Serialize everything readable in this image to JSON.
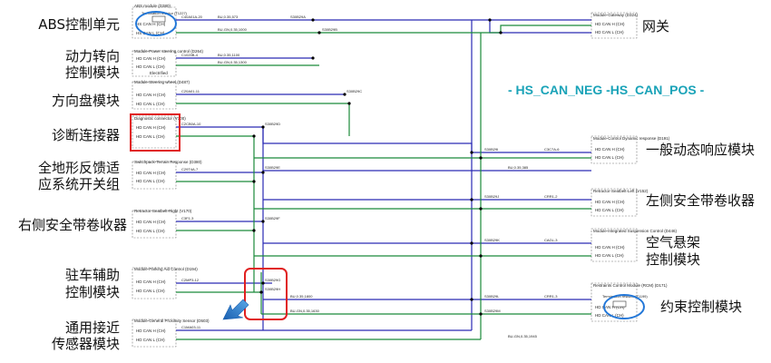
{
  "callouts_left": [
    {
      "id": "abs",
      "lines": [
        "ABS控制单元"
      ]
    },
    {
      "id": "power-steering",
      "lines": [
        "动力转向",
        "控制模块"
      ]
    },
    {
      "id": "steering-wheel",
      "lines": [
        "方向盘模块"
      ]
    },
    {
      "id": "diag-connector",
      "lines": [
        "诊断连接器"
      ]
    },
    {
      "id": "terrain-response",
      "lines": [
        "全地形反馈适",
        "应系统开关组"
      ]
    },
    {
      "id": "right-belt",
      "lines": [
        "右侧安全带卷收器"
      ]
    },
    {
      "id": "park-assist",
      "lines": [
        "驻车辅助",
        "控制模块"
      ]
    },
    {
      "id": "proximity",
      "lines": [
        "通用接近",
        "传感器模块"
      ]
    }
  ],
  "callouts_right": [
    {
      "id": "gateway",
      "lines": [
        "网关"
      ]
    },
    {
      "id": "dynamic-response",
      "lines": [
        "一般动态响应模块"
      ]
    },
    {
      "id": "left-belt",
      "lines": [
        "左侧安全带卷收器"
      ]
    },
    {
      "id": "air-suspension",
      "lines": [
        "空气悬架",
        "控制模块"
      ]
    },
    {
      "id": "restraints",
      "lines": [
        "约束控制模块"
      ]
    }
  ],
  "legend": "- HS_CAN_NEG -HS_CAN_POS -",
  "modules": [
    {
      "id": "abs",
      "title": "ABS module (D380)",
      "pins": [
        "HS CAN H (CH)",
        "HS CAN L (CH)"
      ],
      "terminator": "Termination resistor (T1227)"
    },
    {
      "id": "power-steering",
      "title": "Module-Power steering control (D264)",
      "pins": [
        "HD CAN H (CH)",
        "HD CAN L (CH)"
      ],
      "sub": "Electrified"
    },
    {
      "id": "steering-wheel",
      "title": "Module-Steering wheel (D487)",
      "pins": [
        "HD CAN H (CH)",
        "HD CAN L (CH)"
      ]
    },
    {
      "id": "diag-connector",
      "title": "Diagnostic connector (V100)",
      "pins": [
        "HD CAN H (CH)",
        "HD CAN L (CH)"
      ]
    },
    {
      "id": "terrain-response",
      "title": "Switchpack-Terrain Response (D380)",
      "pins": [
        "HD CAN H (CH)",
        "HD CAN L (CH)"
      ]
    },
    {
      "id": "right-belt",
      "title": "Retractor-Seatbelt-Right (V170)",
      "pins": [
        "HD CAN H (CH)",
        "HD CAN L (CH)"
      ]
    },
    {
      "id": "park-assist",
      "title": "Module-Parking Aid Control (D194)",
      "pins": [
        "HD CAN H (CH)",
        "HD CAN L (CH)"
      ]
    },
    {
      "id": "proximity",
      "title": "Module-General Proximity Sensor (D503)",
      "pins": [
        "HD CAN H (CH)",
        "HD CAN L (CH)"
      ]
    },
    {
      "id": "gateway",
      "title": "Module-Gateway (D324)",
      "pins": [
        "HD CAN H (CH)",
        "HD CAN L (CH)"
      ]
    },
    {
      "id": "dynamic-response",
      "title": "Module-Control Dynamic response (D191)",
      "pins": [
        "HD CAN H (CH)",
        "HD CAN L (CH)"
      ]
    },
    {
      "id": "left-belt",
      "title": "Retractor-Seatbelt-Left (V152)",
      "pins": [
        "HD CAN H (CH)",
        "HD CAN L (CH)"
      ]
    },
    {
      "id": "air-suspension",
      "title": "Module-Integrated Suspension Control (D446)",
      "pins": [
        "HD CAN H (CH)",
        "HD CAN L (CH)"
      ]
    },
    {
      "id": "restraints",
      "title": "Restraints Control Module (RCM) (D171)",
      "pins": [
        "HD CAN H (CH)",
        "HD CAN L (CH)"
      ],
      "terminator": "Termination resistor (T1199)"
    }
  ],
  "splices": [
    "S30B29A",
    "S30B29B",
    "S30B29C",
    "S30B29D",
    "S30B29E",
    "S30B29F",
    "S30B29G",
    "S30B29H",
    "S30B29I",
    "S30B29J",
    "S30B29K",
    "S30B29L",
    "S30B29M"
  ],
  "wire_labels": [
    "BU,0.35,573",
    "BU-GN,0.35,1000",
    "BU,0.35,1100",
    "BU-GN,0.35,1300",
    "BU,0.35,1800",
    "BU-GN,0.35,1630",
    "BU,0.35,385",
    "BU-GN,0.35,1945"
  ],
  "connectors": [
    "C40A01A-20",
    "C1020B-4",
    "C20A01-11",
    "C2CB0A-10",
    "C29T4A-7",
    "C3F1-3",
    "C2MP3-12",
    "C1MA03-11",
    "C1N01-17",
    "C3C7A-6",
    "CRR1-2",
    "CAGL-3",
    "CRR1-3"
  ],
  "colors": {
    "pos": "#2a2ab5",
    "neg": "#1a8a3a",
    "legend": "#1aa3b8",
    "highlight_red": "#e02020",
    "highlight_blue": "#2277d8",
    "arrow": "#2f80d0"
  }
}
